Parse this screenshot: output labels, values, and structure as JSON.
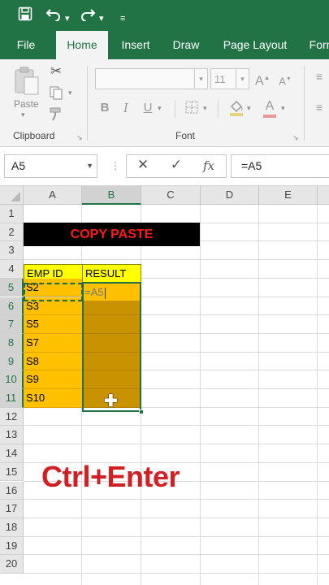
{
  "colors": {
    "excel_green": "#217346",
    "header_yellow": "#ffff00",
    "id_orange": "#ffc000",
    "result_dark": "#c99300",
    "banner_red": "#ff1a1a",
    "overlay_red": "#d21f24"
  },
  "quick_access": {
    "save_icon": "save-icon",
    "undo_icon": "undo-icon",
    "redo_icon": "redo-icon",
    "customize_icon": "customize-icon"
  },
  "tabs": [
    {
      "label": "File"
    },
    {
      "label": "Home"
    },
    {
      "label": "Insert"
    },
    {
      "label": "Draw"
    },
    {
      "label": "Page Layout"
    },
    {
      "label": "Form"
    }
  ],
  "ribbon": {
    "paste_label": "Paste",
    "clipboard_group": "Clipboard",
    "font_group": "Font",
    "font_size": "11",
    "bold": "B",
    "italic": "I",
    "underline": "U",
    "font_color": "A"
  },
  "formula_bar": {
    "name_box": "A5",
    "cancel": "✕",
    "enter": "✓",
    "fx": "fx",
    "formula": "=A5"
  },
  "grid": {
    "columns": [
      "A",
      "B",
      "C",
      "D",
      "E"
    ],
    "rows": [
      "1",
      "2",
      "3",
      "4",
      "5",
      "6",
      "7",
      "8",
      "9",
      "10",
      "11",
      "12",
      "13",
      "14",
      "15",
      "16",
      "17",
      "18",
      "19",
      "20"
    ],
    "banner": "COPY PASTE",
    "header_emp_id": "EMP ID",
    "header_result": "RESULT",
    "emp_ids": [
      "S2",
      "S3",
      "S5",
      "S7",
      "S8",
      "S9",
      "S10"
    ],
    "editing_value": "=A5"
  },
  "overlay_text": "Ctrl+Enter"
}
